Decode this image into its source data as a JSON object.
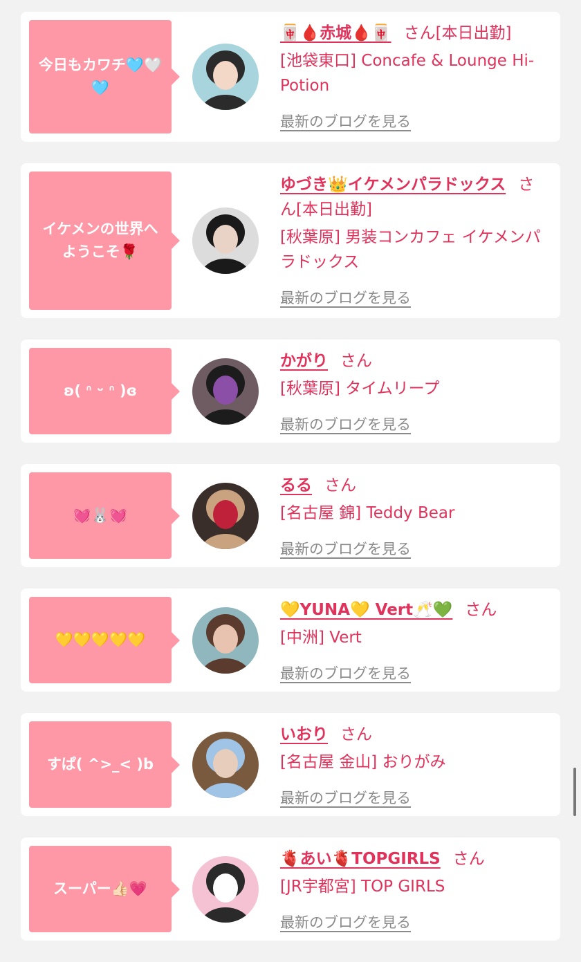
{
  "cards": [
    {
      "bubble": "今日もカワチ🩵🤍🩵",
      "name": "🀄🩸赤城🩸🀄",
      "suffix": "さん[本日出勤]",
      "shop": "[池袋東口] Concafe & Lounge Hi-Potion",
      "blog": "最新のブログを見る",
      "avatar_colors": [
        "#a8d5dd",
        "#2b2b2b",
        "#f3d8c8"
      ]
    },
    {
      "bubble": "イケメンの世界へ\nようこそ🌹",
      "name": "ゆづき👑イケメンパラドックス",
      "suffix": "さん[本日出勤]",
      "shop": "[秋葉原] 男装コンカフェ イケメンパラドックス",
      "blog": "最新のブログを見る",
      "avatar_colors": [
        "#dcdcdc",
        "#1a1a1a",
        "#e9d2c6"
      ]
    },
    {
      "bubble": "ʚ( ᐢ ᵕ ᐢ )ɞ",
      "name": "かがり",
      "suffix": "さん",
      "shop": "[秋葉原] タイムリープ",
      "blog": "最新のブログを見る",
      "avatar_colors": [
        "#6f5c63",
        "#1c1c1c",
        "#8c4fa8"
      ]
    },
    {
      "bubble": "💓🐰💓",
      "name": "るる",
      "suffix": "さん",
      "shop": "[名古屋 錦] Teddy Bear",
      "blog": "最新のブログを見る",
      "avatar_colors": [
        "#3a2e2b",
        "#c9a27f",
        "#c0213a"
      ]
    },
    {
      "bubble": "💛💛💛💛💛",
      "name": "💛YUNA💛 Vert🥂💚",
      "suffix": "さん",
      "shop": "[中洲] Vert",
      "blog": "最新のブログを見る",
      "avatar_colors": [
        "#8fb7bd",
        "#5a3b2e",
        "#e8c3b0"
      ]
    },
    {
      "bubble": "すぱ( ^>_< )b",
      "name": "いおり",
      "suffix": "さん",
      "shop": "[名古屋 金山] おりがみ",
      "blog": "最新のブログを見る",
      "avatar_colors": [
        "#7a5a3f",
        "#9fc4e6",
        "#e7cdbb"
      ]
    },
    {
      "bubble": "スーパー👍🏻💗",
      "name": "🫀あい🫀TOPGIRLS",
      "suffix": "さん",
      "shop": "[JR宇都宮] TOP GIRLS",
      "blog": "最新のブログを見る",
      "avatar_colors": [
        "#f5c2d4",
        "#2a2a2a",
        "#ffffff"
      ]
    }
  ]
}
